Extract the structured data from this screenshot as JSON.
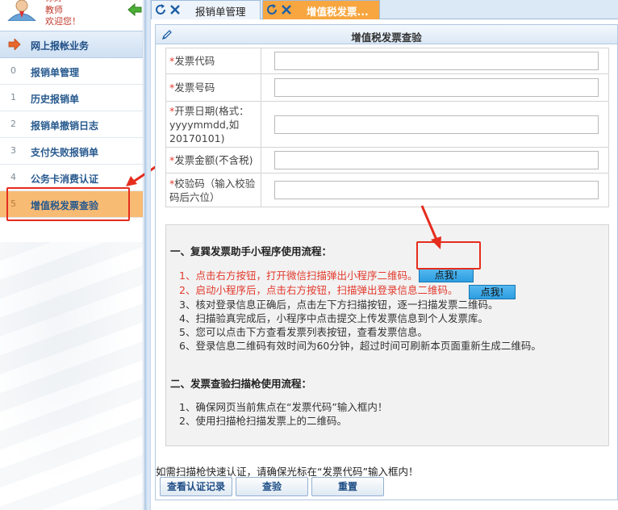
{
  "sidebar": {
    "user_top": "你好",
    "user_role": "教师",
    "user_welcome": "欢迎您！",
    "header": "网上报帐业务",
    "items": [
      {
        "num": "0",
        "label": "报销单管理"
      },
      {
        "num": "1",
        "label": "历史报销单"
      },
      {
        "num": "2",
        "label": "报销单撤销日志"
      },
      {
        "num": "3",
        "label": "支付失败报销单"
      },
      {
        "num": "4",
        "label": "公务卡消费认证"
      },
      {
        "num": "5",
        "label": "增值税发票查验"
      }
    ],
    "active_index": 5
  },
  "tabs": [
    {
      "label": "报销单管理",
      "active": false
    },
    {
      "label": "增值税发票...",
      "active": true
    }
  ],
  "panel": {
    "title": "增值税发票查验",
    "fields": [
      {
        "required": "*",
        "label": "发票代码",
        "value": ""
      },
      {
        "required": "*",
        "label": "发票号码",
        "value": ""
      },
      {
        "required": "*",
        "label": "开票日期(格式：yyyymmdd,如20170101)",
        "value": ""
      },
      {
        "required": "*",
        "label": "发票金额(不含税)",
        "value": ""
      },
      {
        "required": "*",
        "label": "校验码（输入校验码后六位）",
        "value": ""
      }
    ],
    "guide": {
      "section1_title": "一、复巽发票助手小程序使用流程：",
      "steps1": [
        "1、点击右方按钮，打开微信扫描弹出小程序二维码。",
        "2、启动小程序后，点击右方按钮，扫描弹出登录信息二维码。",
        "3、核对登录信息正确后，点击左下方扫描按钮，逐一扫描发票二维码。",
        "4、扫描验真完成后，小程序中点击提交上传发票信息到个人发票库。",
        "5、您可以点击下方查看发票列表按钮，查看发票信息。",
        "6、登录信息二维码有效时间为60分钟，超过时间可刷新本页面重新生成二维码。"
      ],
      "click_button": "点我!",
      "click_button2": "点我!",
      "section2_title": "二、发票查验扫描枪使用流程：",
      "steps2": [
        "1、确保网页当前焦点在“发票代码”输入框内！",
        "2、使用扫描枪扫描发票上的二维码。"
      ]
    },
    "hint": "如需扫描枪快速认证，请确保光标在“发票代码”输入框内！",
    "buttons": {
      "view_records": "查看认证记录",
      "verify": "查验",
      "reset": "重置"
    }
  },
  "colors": {
    "accent_orange": "#f7a640",
    "active_item": "#f8bb74",
    "required_red": "#e23a2d",
    "annotation_red": "#e52d1e",
    "button_blue": "#2d9de0"
  }
}
